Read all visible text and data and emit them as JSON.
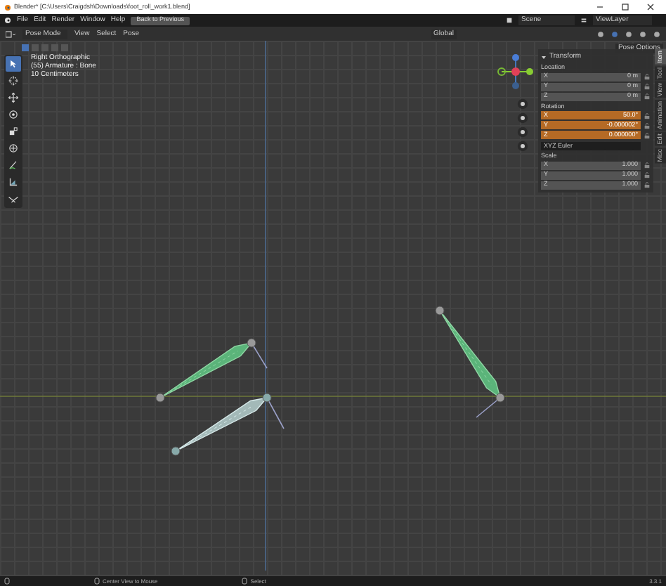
{
  "window": {
    "title": "Blender* [C:\\Users\\Craigdsh\\Downloads\\foot_roll_work1.blend]"
  },
  "menu": [
    {
      "label": "File"
    },
    {
      "label": "Edit"
    },
    {
      "label": "Render"
    },
    {
      "label": "Window"
    },
    {
      "label": "Help"
    }
  ],
  "back_button": "Back to Previous",
  "scene": "Scene",
  "view_layer": "ViewLayer",
  "header": {
    "mode": "Pose Mode",
    "menus": [
      "View",
      "Select",
      "Pose"
    ],
    "orientation": "Global",
    "pose_options": "Pose Options"
  },
  "overlay_text": [
    "Right Orthographic",
    "(55) Armature : Bone",
    "10 Centimeters"
  ],
  "tools": [
    {
      "kind": "select",
      "selected": true
    },
    {
      "kind": "cursor",
      "selected": false
    },
    {
      "kind": "move",
      "selected": false
    },
    {
      "kind": "rotate",
      "selected": false
    },
    {
      "kind": "scale",
      "selected": false
    },
    {
      "kind": "transform",
      "selected": false
    },
    {
      "kind": "annotate",
      "selected": false
    },
    {
      "kind": "measure",
      "selected": false
    },
    {
      "kind": "roll",
      "selected": false
    }
  ],
  "transform": {
    "title": "Transform",
    "groups": [
      {
        "label": "Location",
        "keyframed": false,
        "rows": [
          {
            "axis": "X",
            "value": "0 m"
          },
          {
            "axis": "Y",
            "value": "0 m"
          },
          {
            "axis": "Z",
            "value": "0 m"
          }
        ]
      },
      {
        "label": "Rotation",
        "keyframed": true,
        "rows": [
          {
            "axis": "X",
            "value": "50.0°"
          },
          {
            "axis": "Y",
            "value": "-0.000002°"
          },
          {
            "axis": "Z",
            "value": "0.000000°"
          }
        ]
      },
      {
        "label": "Scale",
        "keyframed": false,
        "rows": [
          {
            "axis": "X",
            "value": "1.000"
          },
          {
            "axis": "Y",
            "value": "1.000"
          },
          {
            "axis": "Z",
            "value": "1.000"
          }
        ]
      }
    ],
    "rotation_mode": "XYZ Euler"
  },
  "sidebar_tabs": [
    {
      "label": "Item",
      "selected": true
    },
    {
      "label": "Tool",
      "selected": false
    },
    {
      "label": "View",
      "selected": false
    },
    {
      "label": "Animation",
      "selected": false
    },
    {
      "label": "Edit",
      "selected": false
    },
    {
      "label": "Misc",
      "selected": false
    }
  ],
  "status_bar": {
    "items": [
      "Center View to Mouse",
      "Select"
    ],
    "version": "3.3.1"
  }
}
